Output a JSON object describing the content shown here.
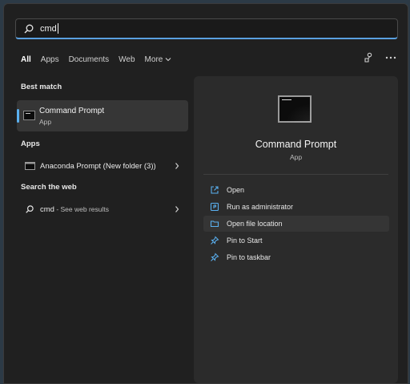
{
  "search": {
    "value": "cmd"
  },
  "tabs": [
    {
      "label": "All",
      "active": true
    },
    {
      "label": "Apps"
    },
    {
      "label": "Documents"
    },
    {
      "label": "Web"
    },
    {
      "label": "More"
    }
  ],
  "toolbar_icons": [
    "share-icon",
    "more-options-icon"
  ],
  "best_match": {
    "section_title": "Best match",
    "name": "Command Prompt",
    "type": "App",
    "icon": "command-prompt-icon"
  },
  "apps": {
    "section_title": "Apps",
    "items": [
      {
        "label": "Anaconda Prompt (New folder (3))",
        "icon": "terminal-icon"
      }
    ]
  },
  "web": {
    "section_title": "Search the web",
    "query": "cmd",
    "suffix": " - See web results",
    "icon": "search-icon"
  },
  "details": {
    "title": "Command Prompt",
    "subtitle": "App",
    "actions": [
      {
        "label": "Open",
        "icon": "open-external-icon"
      },
      {
        "label": "Run as administrator",
        "icon": "admin-shield-icon"
      },
      {
        "label": "Open file location",
        "icon": "folder-icon",
        "highlighted": true
      },
      {
        "label": "Pin to Start",
        "icon": "pin-icon"
      },
      {
        "label": "Pin to taskbar",
        "icon": "pin-icon"
      }
    ]
  },
  "colors": {
    "accent": "#5ab0f0",
    "background": "#202020",
    "panel": "#2b2b2b"
  }
}
